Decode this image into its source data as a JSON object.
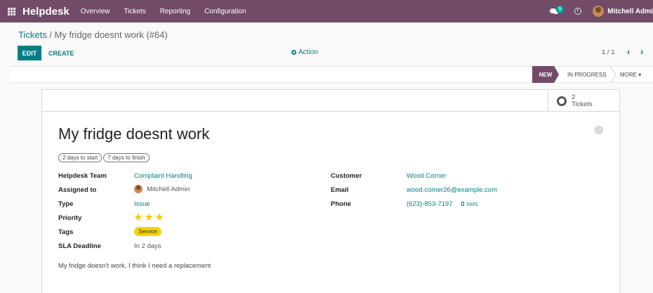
{
  "navbar": {
    "brand": "Helpdesk",
    "menu": [
      "Overview",
      "Tickets",
      "Reporting",
      "Configuration"
    ],
    "messages_count": "5",
    "user_name": "Mitchell Admin"
  },
  "breadcrumb": {
    "parent": "Tickets",
    "separator": " / ",
    "current": "My fridge doesnt work (#64)"
  },
  "toolbar": {
    "edit_label": "EDIT",
    "create_label": "CREATE",
    "action_label": "Action"
  },
  "pager": {
    "value": "1 / 1",
    "prev": "‹",
    "next": "›"
  },
  "statusbar": {
    "stages": [
      "NEW",
      "IN PROGRESS"
    ],
    "active_stage": "NEW",
    "more_label": "MORE ▾"
  },
  "smart_button": {
    "count": "2",
    "label": "Tickets"
  },
  "ticket": {
    "title": "My fridge doesnt work",
    "chips": [
      "2 days to start",
      "7 days to finish"
    ],
    "fields_left": [
      {
        "label": "Helpdesk Team",
        "value": "Complaint Handling"
      },
      {
        "label": "Assigned to",
        "value": "Mitchell Admin"
      },
      {
        "label": "Type",
        "value": "Issue"
      },
      {
        "label": "Priority",
        "value": ""
      },
      {
        "label": "Tags",
        "value": "Service"
      },
      {
        "label": "SLA Deadline",
        "value": "In 2 days"
      }
    ],
    "priority_stars": 3,
    "fields_right": [
      {
        "label": "Customer",
        "value": "Wood Corner"
      },
      {
        "label": "Email",
        "value": "wood.corner26@example.com"
      },
      {
        "label": "Phone",
        "value": "(623)-853-7197"
      }
    ],
    "sms_label": "SMS",
    "description": "My fridge doesn't work, I think I need a replacement"
  },
  "colors": {
    "navbar": "#714b67",
    "accent": "#017e84",
    "star": "#f3cc00",
    "tag": "#f5d20a"
  }
}
